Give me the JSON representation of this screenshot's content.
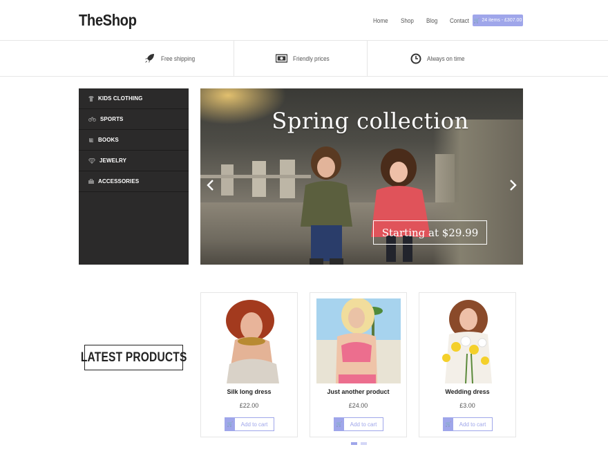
{
  "brand": {
    "logo": "TheShop"
  },
  "nav": {
    "items": [
      "Home",
      "Shop",
      "Blog",
      "Contact"
    ],
    "cart_label": "24 items - £307.00"
  },
  "features": [
    {
      "label": "Free shipping",
      "icon": "rocket-icon"
    },
    {
      "label": "Friendly prices",
      "icon": "money-icon"
    },
    {
      "label": "Always on time",
      "icon": "clock-icon"
    }
  ],
  "sidebar": {
    "items": [
      {
        "label": "KIDS CLOTHING",
        "icon": "shirt-icon"
      },
      {
        "label": "SPORTS",
        "icon": "bicycle-icon"
      },
      {
        "label": "BOOKS",
        "icon": "book-icon"
      },
      {
        "label": "JEWELRY",
        "icon": "diamond-icon"
      },
      {
        "label": "ACCESSORIES",
        "icon": "briefcase-icon"
      }
    ]
  },
  "hero": {
    "title": "Spring collection",
    "price_label": "Starting at $29.99",
    "prev_icon": "chevron-left-icon",
    "next_icon": "chevron-right-icon"
  },
  "latest": {
    "heading": "LATEST PRODUCTS"
  },
  "products": [
    {
      "name": "Silk long dress",
      "price": "£22.00",
      "button": "Add to cart"
    },
    {
      "name": "Just another product",
      "price": "£24.00",
      "button": "Add to cart"
    },
    {
      "name": "Wedding dress",
      "price": "£3.00",
      "button": "Add to cart"
    }
  ],
  "colors": {
    "accent": "#9fa6ea",
    "sidebar_bg": "#2b2a2a"
  }
}
